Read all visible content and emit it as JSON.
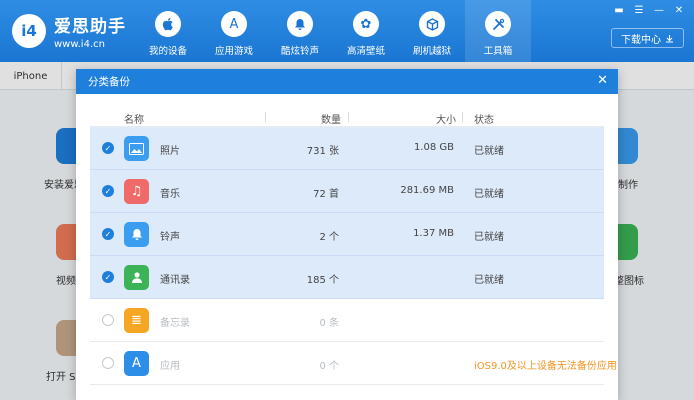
{
  "app": {
    "logo_badge": "i4",
    "name": "爱思助手",
    "url": "www.i4.cn",
    "download_label": "下载中心",
    "win_controls": [
      "▬",
      "☰",
      "—",
      "✕"
    ]
  },
  "nav": [
    {
      "label": "我的设备",
      "icon": "apple-icon",
      "glyph": ""
    },
    {
      "label": "应用游戏",
      "icon": "appstore-icon",
      "glyph": "A"
    },
    {
      "label": "酷炫铃声",
      "icon": "bell-icon",
      "glyph": "🔔"
    },
    {
      "label": "高清壁纸",
      "icon": "flower-icon",
      "glyph": "✿"
    },
    {
      "label": "刷机越狱",
      "icon": "box-icon",
      "glyph": "⧈"
    },
    {
      "label": "工具箱",
      "icon": "tools-icon",
      "glyph": "✕"
    }
  ],
  "background": {
    "tab_label": "iPhone",
    "left_labels": [
      "安装爱思",
      "视频",
      "打开 SS"
    ],
    "right_labels": [
      "制作",
      "整图标"
    ]
  },
  "dialog": {
    "title": "分类备份",
    "close": "✕",
    "columns": {
      "name": "名称",
      "count": "数量",
      "size": "大小",
      "status": "状态"
    },
    "rows": [
      {
        "name": "照片",
        "count": "731 张",
        "size": "1.08 GB",
        "status": "已就绪",
        "checked": true,
        "icon": "photos-icon",
        "glyph": "▲",
        "color": "#3a9df0"
      },
      {
        "name": "音乐",
        "count": "72 首",
        "size": "281.69 MB",
        "status": "已就绪",
        "checked": true,
        "icon": "music-icon",
        "glyph": "♫",
        "color": "#f06a6a"
      },
      {
        "name": "铃声",
        "count": "2 个",
        "size": "1.37 MB",
        "status": "已就绪",
        "checked": true,
        "icon": "ringtone-icon",
        "glyph": "🔔",
        "color": "#3a9df0"
      },
      {
        "name": "通讯录",
        "count": "185 个",
        "size": "",
        "status": "已就绪",
        "checked": true,
        "icon": "contacts-icon",
        "glyph": "👤",
        "color": "#3bb356"
      },
      {
        "name": "备忘录",
        "count": "0 条",
        "size": "",
        "status": "",
        "checked": false,
        "icon": "notes-icon",
        "glyph": "≣",
        "color": "#f5a623"
      },
      {
        "name": "应用",
        "count": "0 个",
        "size": "",
        "status": "iOS9.0及以上设备无法备份应用",
        "checked": false,
        "icon": "apps-icon",
        "glyph": "A",
        "color": "#2d8ee8"
      }
    ]
  },
  "colors": {
    "accent": "#1e7fdc",
    "warning": "#f39423",
    "selected_row": "#ddeafa"
  }
}
